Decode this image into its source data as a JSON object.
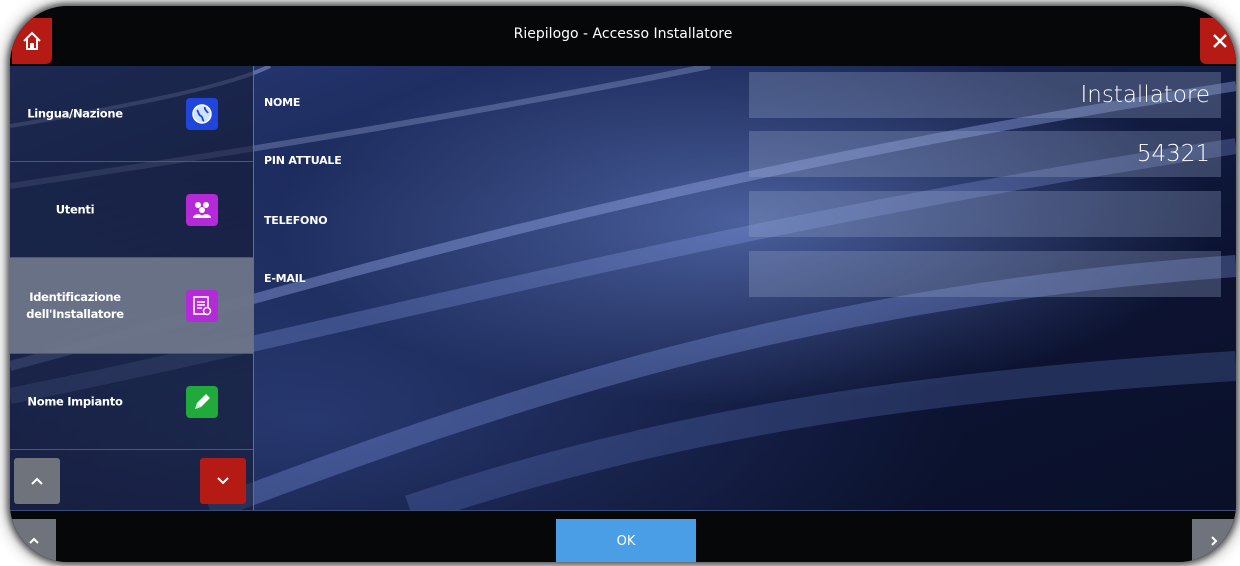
{
  "window": {
    "title": "Riepilogo - Accesso Installatore"
  },
  "top_buttons": {
    "home_icon": "home-icon",
    "close_icon": "close-icon"
  },
  "sidebar": {
    "items": [
      {
        "label": "Lingua/Nazione",
        "icon": "globe-icon",
        "icon_color": "#1f46d8",
        "active": false
      },
      {
        "label": "Utenti",
        "icon": "users-icon",
        "icon_color": "#b42ad8",
        "active": false
      },
      {
        "label": "Identificazione dell'Installatore",
        "icon": "installer-id-icon",
        "icon_color": "#b42ad8",
        "active": true
      },
      {
        "label": "Nome Impianto",
        "icon": "pencil-icon",
        "icon_color": "#1faa3b",
        "active": false
      }
    ],
    "scroll_up_icon": "chevron-up-icon",
    "scroll_down_icon": "chevron-down-icon"
  },
  "form": {
    "fields": [
      {
        "label": "NOME",
        "value": "Installatore"
      },
      {
        "label": "PIN ATTUALE",
        "value": "54321"
      },
      {
        "label": "TELEFONO",
        "value": ""
      },
      {
        "label": "E-MAIL",
        "value": ""
      }
    ]
  },
  "footer": {
    "ok_label": "OK"
  },
  "colors": {
    "accent_red": "#b51a14",
    "ok_blue": "#4a9ee6",
    "bar_black": "#060708"
  }
}
